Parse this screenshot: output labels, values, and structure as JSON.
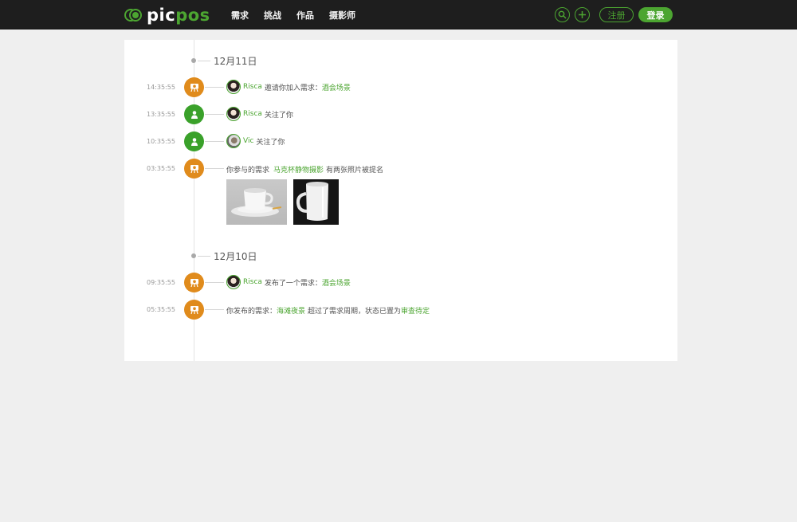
{
  "brand": {
    "logo_white": "pic",
    "logo_green": "pos"
  },
  "nav": {
    "items": [
      "需求",
      "挑战",
      "作品",
      "摄影师"
    ]
  },
  "header": {
    "register_label": "注册",
    "login_label": "登录"
  },
  "colors": {
    "accent": "#4ca531",
    "orange": "#e08b1c",
    "topbar": "#1e1e1e"
  },
  "timeline": {
    "groups": [
      {
        "date": "12月11日",
        "events": [
          {
            "time": "14:35:55",
            "icon": "camera-icon",
            "user": "Risca",
            "text": "邀请你加入需求：",
            "link": "酒会场景"
          },
          {
            "time": "13:35:55",
            "icon": "person-icon",
            "user": "Risca",
            "text": "关注了你"
          },
          {
            "time": "10:35:55",
            "icon": "person-icon",
            "user": "Vic",
            "text": "关注了你"
          },
          {
            "time": "03:35:55",
            "icon": "camera-icon",
            "text_before": "你参与的需求",
            "link": "马克杯静物摄影",
            "text_after": "有两张照片被提名"
          }
        ]
      },
      {
        "date": "12月10日",
        "events": [
          {
            "time": "09:35:55",
            "icon": "camera-icon",
            "user": "Risca",
            "text": "发布了一个需求：",
            "link": "酒会场景"
          },
          {
            "time": "05:35:55",
            "icon": "camera-icon",
            "text_before": "你发布的需求：",
            "link": "海滩夜景",
            "text_middle": "超过了需求周期，状态已置为",
            "link2": "审查待定"
          }
        ]
      }
    ]
  }
}
